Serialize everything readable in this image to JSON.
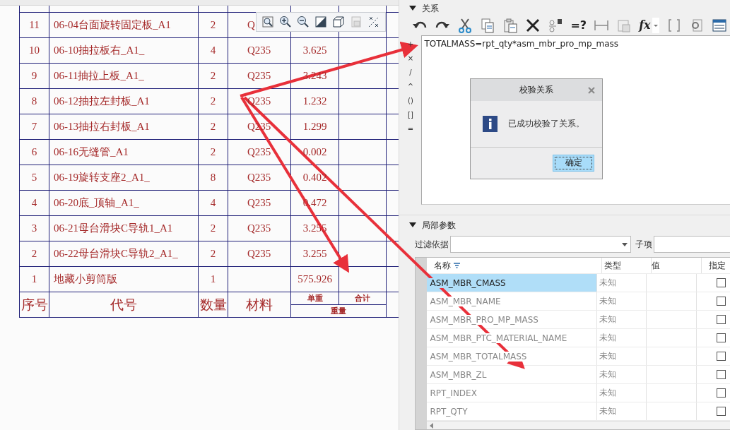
{
  "drawing_table": {
    "rows": [
      {
        "index": "11",
        "code": "06-04台面旋转固定板_A1",
        "qty": "2",
        "material": "Q",
        "unit_weight": ""
      },
      {
        "index": "10",
        "code": "06-10抽拉板右_A1_",
        "qty": "4",
        "material": "Q235",
        "unit_weight": "3.625"
      },
      {
        "index": "9",
        "code": "06-11抽拉上板_A1_",
        "qty": "2",
        "material": "Q235",
        "unit_weight": "3.243"
      },
      {
        "index": "8",
        "code": "06-12抽拉左封板_A1",
        "qty": "2",
        "material": "Q235",
        "unit_weight": "1.232"
      },
      {
        "index": "7",
        "code": "06-13抽拉右封板_A1",
        "qty": "2",
        "material": "Q235",
        "unit_weight": "1.299"
      },
      {
        "index": "6",
        "code": "06-16无缝管_A1",
        "qty": "2",
        "material": "Q235",
        "unit_weight": "0.002"
      },
      {
        "index": "5",
        "code": "06-19旋转支座2_A1_",
        "qty": "8",
        "material": "Q235",
        "unit_weight": "0.402"
      },
      {
        "index": "4",
        "code": "06-20底_顶轴_A1_",
        "qty": "4",
        "material": "Q235",
        "unit_weight": "0.472"
      },
      {
        "index": "3",
        "code": "06-21母台滑块C导轨1_A1",
        "qty": "2",
        "material": "Q235",
        "unit_weight": "3.255"
      },
      {
        "index": "2",
        "code": "06-22母台滑块C导轨2_A1_",
        "qty": "2",
        "material": "Q235",
        "unit_weight": "3.255"
      },
      {
        "index": "1",
        "code": "地藏小剪筒版",
        "qty": "1",
        "material": "",
        "unit_weight": "575.926"
      }
    ],
    "header": {
      "index": "序号",
      "code": "代号",
      "qty": "数量",
      "material": "材料",
      "unit_weight": "单重",
      "total": "合计",
      "weight": "重量"
    }
  },
  "relations": {
    "title": "关系",
    "expanded": true,
    "check_label": "=?",
    "function_label": "fx",
    "relation_text": "TOTALMASS=rpt_qty*asm_mbr_pro_mp_mass",
    "operators": [
      "+",
      "×",
      "/",
      "^",
      "()",
      "[]",
      "="
    ]
  },
  "dialog": {
    "title": "校验关系",
    "message": "已成功校验了关系。",
    "ok_button": "确定"
  },
  "local_params": {
    "title": "局部参数",
    "expanded": true,
    "filter_label": "过滤依据",
    "sub_label": "子项",
    "columns": [
      "名称",
      "类型",
      "值",
      "指定"
    ],
    "rows": [
      {
        "name": "ASM_MBR_CMASS",
        "type": "未知",
        "selected": true,
        "specified": false
      },
      {
        "name": "ASM_MBR_NAME",
        "type": "未知",
        "selected": false,
        "specified": false
      },
      {
        "name": "ASM_MBR_PRO_MP_MASS",
        "type": "未知",
        "selected": false,
        "specified": false
      },
      {
        "name": "ASM_MBR_PTC_MATERIAL_NAME",
        "type": "未知",
        "selected": false,
        "specified": false
      },
      {
        "name": "ASM_MBR_TOTALMASS",
        "type": "未知",
        "selected": false,
        "specified": false
      },
      {
        "name": "ASM_MBR_ZL",
        "type": "未知",
        "selected": false,
        "specified": false
      },
      {
        "name": "RPT_INDEX",
        "type": "未知",
        "selected": false,
        "specified": false
      },
      {
        "name": "RPT_QTY",
        "type": "未知",
        "selected": false,
        "specified": false
      }
    ]
  }
}
